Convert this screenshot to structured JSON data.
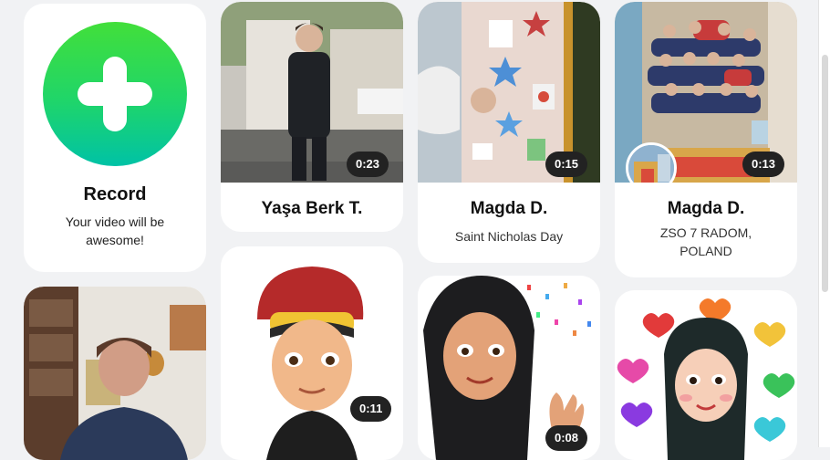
{
  "record": {
    "title": "Record",
    "subtitle": "Your video will be awesome!"
  },
  "videos": [
    {
      "name": "Yaşa Berk T.",
      "caption": "",
      "duration": "0:23"
    },
    {
      "name": "Magda D.",
      "caption": "Saint Nicholas Day",
      "duration": "0:15"
    },
    {
      "name": "Magda D.",
      "caption": "ZSO 7 RADOM, POLAND",
      "duration": "0:13"
    },
    {
      "name": "",
      "caption": "",
      "duration": ""
    },
    {
      "name": "",
      "caption": "",
      "duration": "0:11"
    },
    {
      "name": "",
      "caption": "",
      "duration": "0:08"
    },
    {
      "name": "",
      "caption": "",
      "duration": ""
    }
  ],
  "colors": {
    "record_gradient_top": "#3ddc3d",
    "record_gradient_bottom": "#00c4a0",
    "duration_badge": "#222222"
  }
}
